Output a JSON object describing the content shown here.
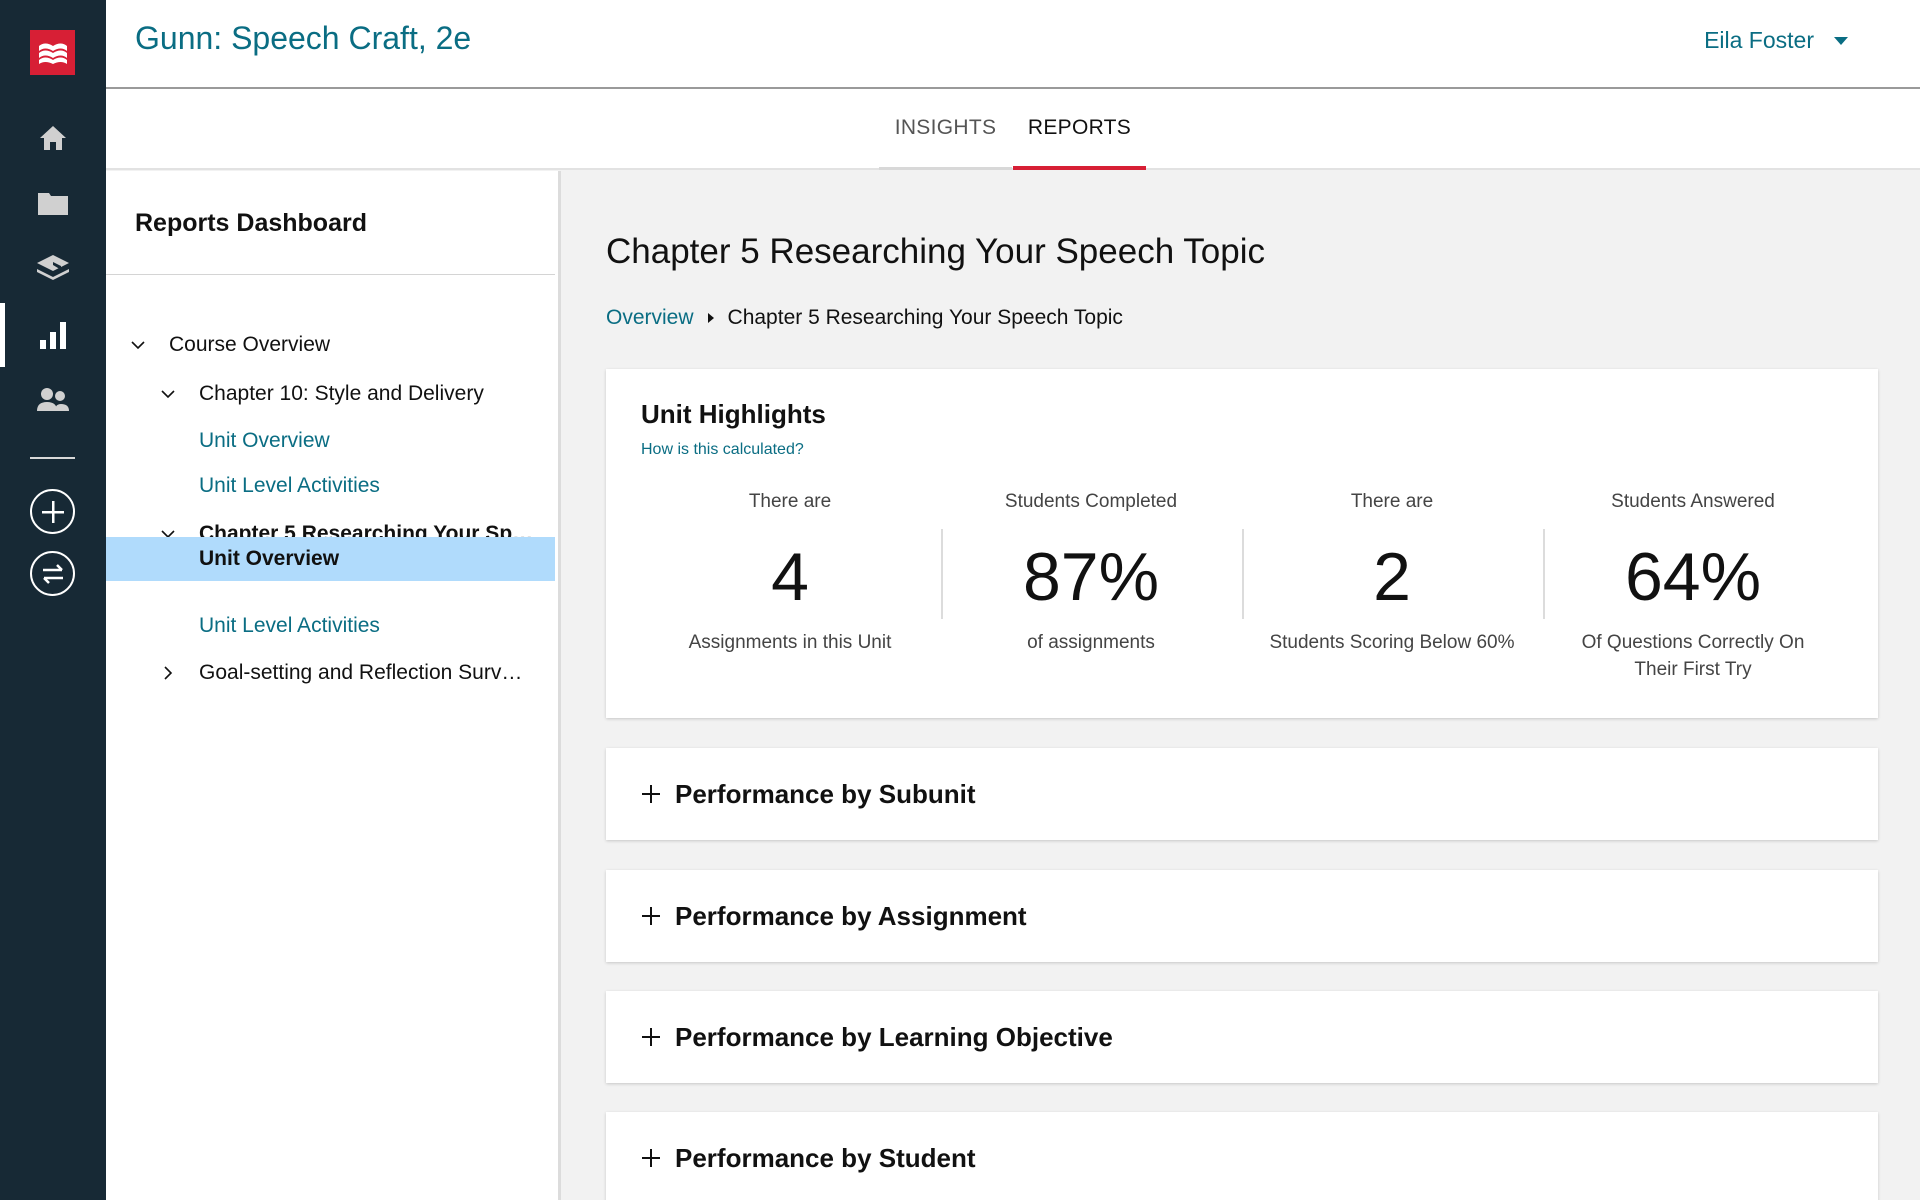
{
  "app": {
    "course_title": "Gunn: Speech Craft, 2e",
    "user_name": "Eila Foster"
  },
  "rail": {
    "items": [
      {
        "icon": "home-icon"
      },
      {
        "icon": "folder-icon"
      },
      {
        "icon": "graduation-cap-icon"
      },
      {
        "icon": "bar-chart-icon",
        "active": true
      },
      {
        "icon": "users-icon"
      }
    ],
    "actions": [
      {
        "icon": "add-circle-icon"
      },
      {
        "icon": "switch-arrows-icon"
      }
    ]
  },
  "tabs": [
    {
      "label": "INSIGHTS",
      "active": false
    },
    {
      "label": "REPORTS",
      "active": true
    }
  ],
  "tree": {
    "title": "Reports Dashboard",
    "items": [
      {
        "label": "Course Overview",
        "level": 0,
        "expander": "expanded"
      },
      {
        "label": "Chapter 10: Style and Delivery",
        "level": 1,
        "expander": "expanded"
      },
      {
        "label": "Unit Overview",
        "level": 2,
        "type": "link"
      },
      {
        "label": "Unit Level Activities",
        "level": 2,
        "type": "link"
      },
      {
        "label": "Chapter 5 Researching Your Sp…",
        "level": 1,
        "expander": "expanded",
        "bold": true
      },
      {
        "label": "Unit Overview",
        "level": 2,
        "selected": true
      },
      {
        "label": "Unit Level Activities",
        "level": 2,
        "type": "link"
      },
      {
        "label": "Goal-setting and Reflection Surv…",
        "level": 1,
        "expander": "collapsed"
      }
    ]
  },
  "main": {
    "page_title": "Chapter 5 Researching Your Speech Topic",
    "breadcrumb": {
      "root": "Overview",
      "current": "Chapter 5 Researching Your Speech Topic"
    },
    "highlights": {
      "title": "Unit Highlights",
      "help_link": "How is this calculated?",
      "stats": [
        {
          "pre": "There are",
          "value": "4",
          "post": "Assignments in this Unit"
        },
        {
          "pre": "Students Completed",
          "value": "87%",
          "post": "of assignments"
        },
        {
          "pre": "There are",
          "value": "2",
          "post": "Students Scoring Below 60%"
        },
        {
          "pre": "Students Answered",
          "value": "64%",
          "post": "Of Questions Correctly On Their First Try"
        }
      ]
    },
    "sections": [
      {
        "label": "Performance by Subunit"
      },
      {
        "label": "Performance by Assignment"
      },
      {
        "label": "Performance by Learning Objective"
      },
      {
        "label": "Performance by Student"
      }
    ]
  },
  "colors": {
    "brand_red": "#d71f35",
    "link_teal": "#0a6d83",
    "rail_bg": "#172935",
    "selected_bg": "#b0dbfc"
  }
}
